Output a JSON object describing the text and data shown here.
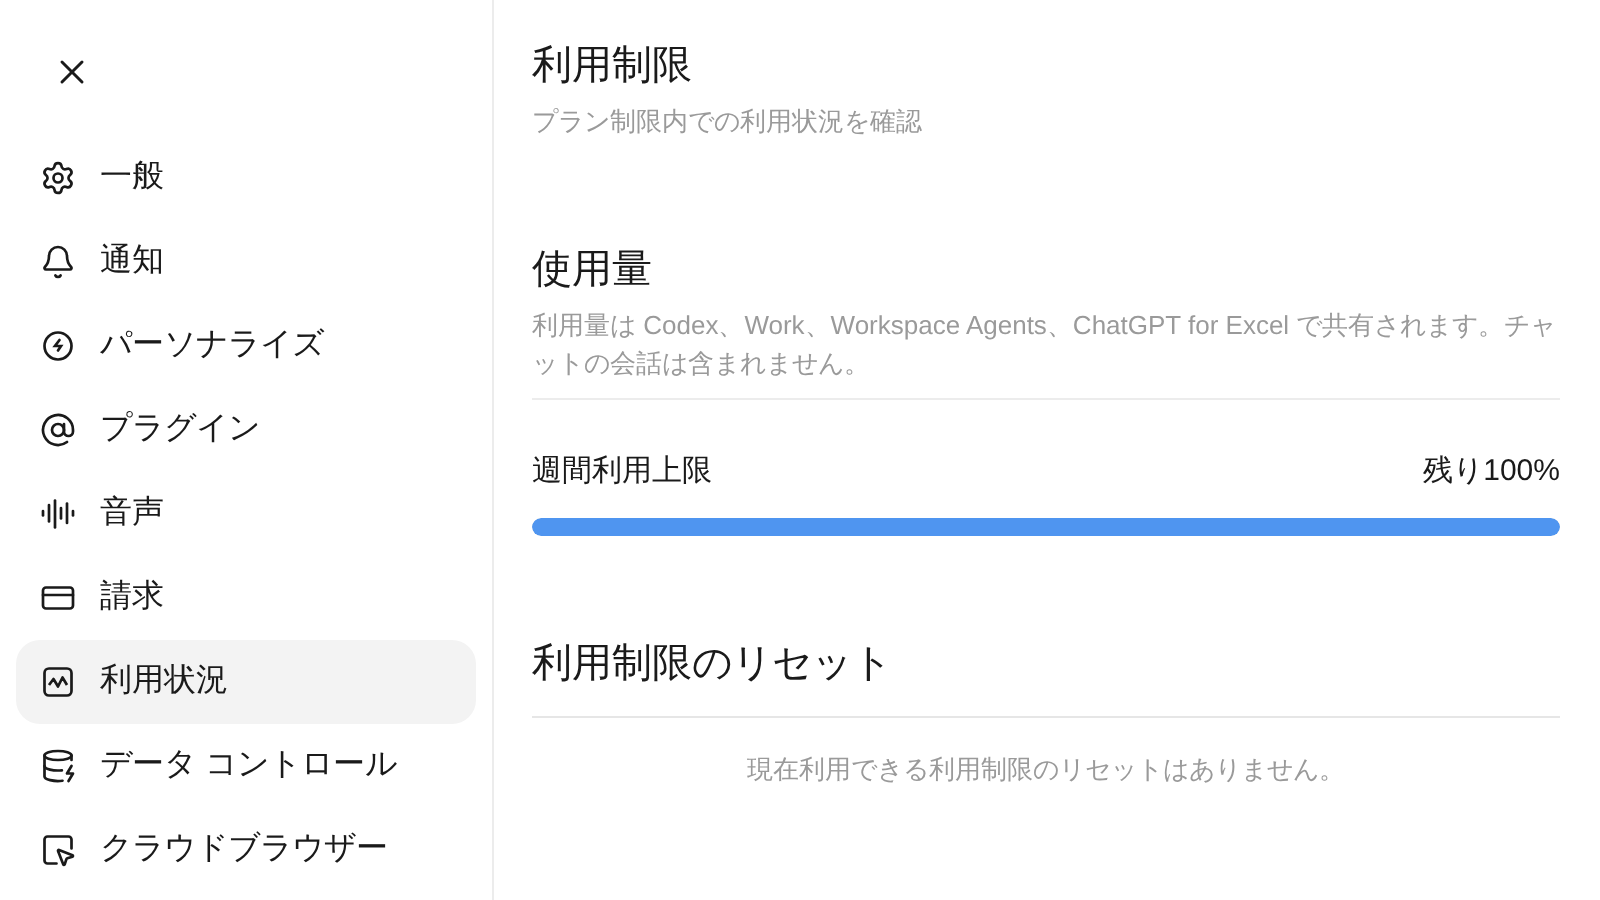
{
  "sidebar": {
    "items": [
      {
        "label": "一般",
        "selected": false
      },
      {
        "label": "通知",
        "selected": false
      },
      {
        "label": "パーソナライズ",
        "selected": false
      },
      {
        "label": "プラグイン",
        "selected": false
      },
      {
        "label": "音声",
        "selected": false
      },
      {
        "label": "請求",
        "selected": false
      },
      {
        "label": "利用状況",
        "selected": true
      },
      {
        "label": "データ コントロール",
        "selected": false
      },
      {
        "label": "クラウドブラウザー",
        "selected": false
      }
    ]
  },
  "header": {
    "title": "利用制限",
    "subtitle": "プラン制限内での利用状況を確認"
  },
  "usage": {
    "title": "使用量",
    "description": "利用量は Codex、Work、Workspace Agents、ChatGPT for Excel で共有されます。チャットの会話は含まれません。",
    "meters": [
      {
        "label": "週間利用上限",
        "reading": "残り100%",
        "level": 1.0
      }
    ]
  },
  "reset": {
    "title": "利用制限のリセット",
    "empty_message": "現在利用できる利用制限のリセットはありません。"
  }
}
